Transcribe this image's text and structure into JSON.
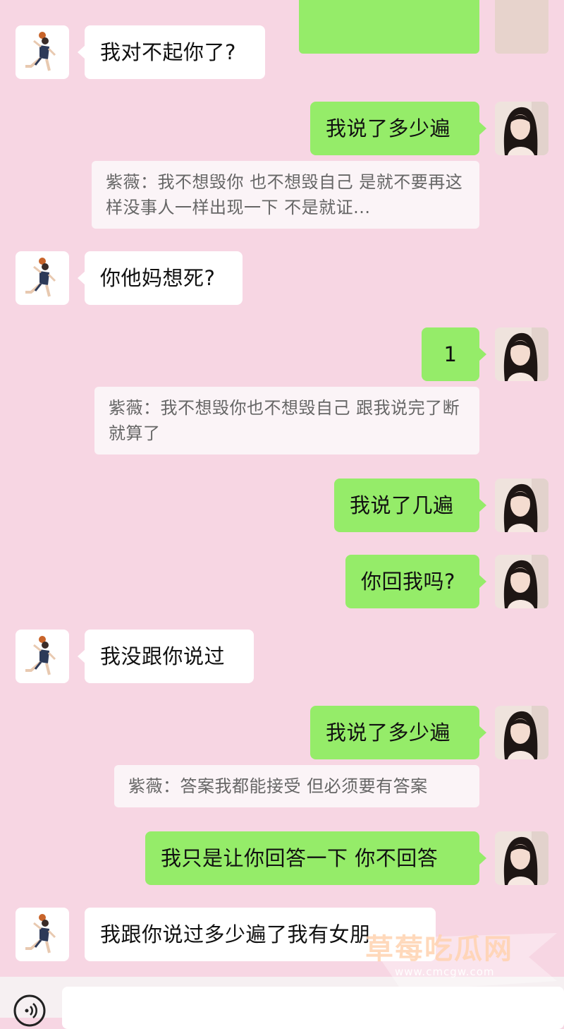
{
  "colors": {
    "background": "#f7d6e3",
    "incoming_bubble": "#ffffff",
    "outgoing_bubble": "#95ec69",
    "quote_background": "#fbf4f7"
  },
  "icons": {
    "sender_avatar": "basketball-player-avatar",
    "self_avatar": "woman-portrait-avatar",
    "voice": "voice-icon"
  },
  "messages": [
    {
      "side": "in",
      "text": "我对不起你了?"
    },
    {
      "side": "out",
      "text": "我说了多少遍",
      "quote": "紫薇：我不想毁你 也不想毁自己  是就不要再这样没事人一样出现一下  不是就证..."
    },
    {
      "side": "in",
      "text": "你他妈想死?"
    },
    {
      "side": "out",
      "text": "1",
      "quote": "紫薇：我不想毁你也不想毁自己 跟我说完了断就算了"
    },
    {
      "side": "out",
      "text": "我说了几遍"
    },
    {
      "side": "out",
      "text": "你回我吗?"
    },
    {
      "side": "in",
      "text": "我没跟你说过"
    },
    {
      "side": "out",
      "text": "我说了多少遍",
      "quote": "紫薇：答案我都能接受 但必须要有答案"
    },
    {
      "side": "out",
      "text": "我只是让你回答一下 你不回答"
    },
    {
      "side": "in",
      "text": "我跟你说过多少遍了我有女朋"
    }
  ],
  "watermark": {
    "title": "草莓吃瓜网",
    "url": "www.cmcgw.com"
  }
}
